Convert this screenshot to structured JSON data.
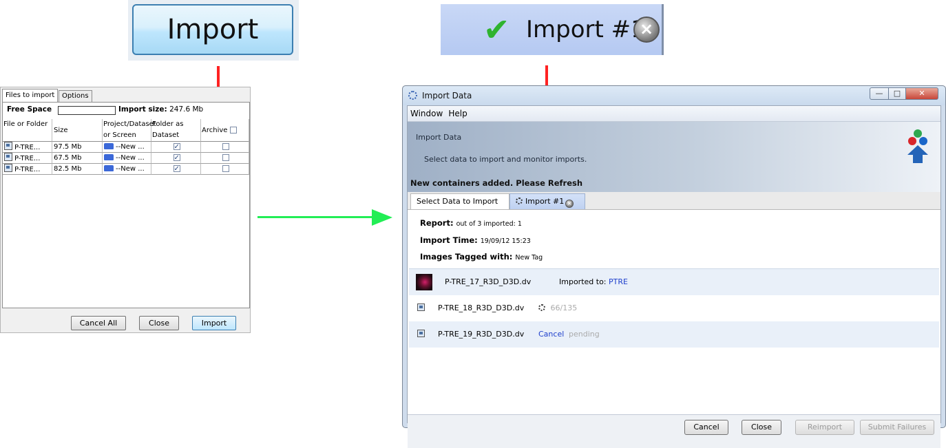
{
  "zoom_button": {
    "label": "Import"
  },
  "zoom_tab": {
    "label": "Import #1"
  },
  "left_panel": {
    "tabs": [
      "Files to import",
      "Options"
    ],
    "free_space_label": "Free Space",
    "import_size_label": "Import size:",
    "import_size_value": "247.6 Mb",
    "columns": [
      "File or Folder",
      "Size",
      "Project/Dataset or Screen",
      "Folder as Dataset",
      "Archive"
    ],
    "rows": [
      {
        "file": "P-TRE...",
        "size": "97.5 Mb",
        "target": "--New ...",
        "folder_as_dataset": true,
        "archive": false
      },
      {
        "file": "P-TRE...",
        "size": "67.5 Mb",
        "target": "--New ...",
        "folder_as_dataset": true,
        "archive": false
      },
      {
        "file": "P-TRE...",
        "size": "82.5 Mb",
        "target": "--New ...",
        "folder_as_dataset": true,
        "archive": false
      }
    ],
    "buttons": {
      "cancel_all": "Cancel All",
      "close": "Close",
      "import": "Import"
    }
  },
  "window": {
    "title": "Import Data",
    "menu": [
      "Window",
      "Help"
    ],
    "banner_title": "Import Data",
    "banner_subtitle": "Select data to import and monitor imports.",
    "notice": "New containers added. Please Refresh",
    "tabs": [
      "Select Data to Import",
      "Import #1"
    ],
    "report": {
      "report_label": "Report:",
      "report_value": "out of 3 imported: 1",
      "time_label": "Import Time:",
      "time_value": "19/09/12 15:23",
      "tagged_label": "Images Tagged with:",
      "tagged_value": "New Tag"
    },
    "files": [
      {
        "name": "P-TRE_17_R3D_D3D.dv",
        "status_label": "Imported to:",
        "status_link": "PTRE"
      },
      {
        "name": "P-TRE_18_R3D_D3D.dv",
        "progress": "66/135"
      },
      {
        "name": "P-TRE_19_R3D_D3D.dv",
        "action": "Cancel",
        "state": "pending"
      }
    ],
    "buttons": {
      "cancel": "Cancel",
      "close": "Close",
      "reimport": "Reimport",
      "submit_failures": "Submit Failures"
    }
  },
  "colors": {
    "arrow_red": "#ff2222",
    "arrow_green": "#22ee55",
    "link_blue": "#1e3fcc"
  }
}
